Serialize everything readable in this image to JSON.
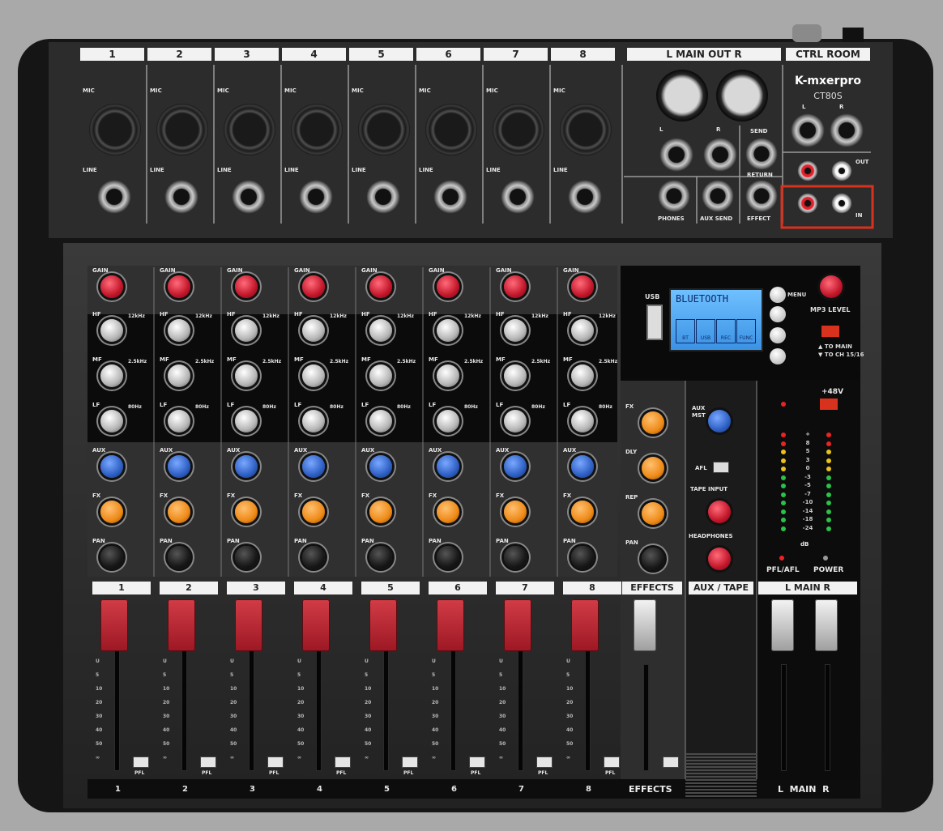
{
  "device": {
    "brand": "K-mxerpro",
    "model": "CT80S"
  },
  "channel_labels": [
    "1",
    "2",
    "3",
    "4",
    "5",
    "6",
    "7",
    "8"
  ],
  "header": {
    "main_out": "L  MAIN OUT  R",
    "ctrl_room": "CTRL ROOM"
  },
  "io_labels": {
    "mic": "MIC",
    "line": "LINE",
    "l": "L",
    "r": "R",
    "send": "SEND",
    "return": "RETURN",
    "phones": "PHONES",
    "aux_send": "AUX SEND",
    "effect": "EFFECT",
    "out": "OUT",
    "in": "IN"
  },
  "channel_knobs": {
    "gain": "GAIN",
    "hf": "HF",
    "mf": "MF",
    "lf": "LF",
    "aux": "AUX",
    "fx": "FX",
    "pan": "PAN",
    "hf_freq": "12kHz",
    "mf_freq": "2.5kHz",
    "lf_freq": "80Hz",
    "pfl": "PFL"
  },
  "mp3": {
    "display_text": "BLUETOOTH",
    "usb": "USB",
    "menu": "MENU",
    "level": "MP3 LEVEL",
    "to_main": "▲ TO MAIN",
    "to_ch": "▼ TO CH 15/16",
    "modes": [
      "BT",
      "USB",
      "REC",
      "FUNC"
    ]
  },
  "effects_section": {
    "fx": "FX",
    "dly": "DLY",
    "rep": "REP",
    "pan": "PAN",
    "strip": "EFFECTS",
    "bottom": "EFFECTS"
  },
  "aux_section": {
    "aux_mst": "AUX\nMST",
    "afl": "AFL",
    "tape_input": "TAPE INPUT",
    "headphones": "HEADPHONES",
    "strip": "AUX / TAPE"
  },
  "main_section": {
    "phantom": "+48V",
    "meter": [
      "+",
      "8",
      "5",
      "3",
      "0",
      "-3",
      "-5",
      "-7",
      "-10",
      "-14",
      "-18",
      "-24"
    ],
    "db": "dB",
    "pfl_afl": "PFL/AFL",
    "power": "POWER",
    "strip": "L  MAIN  R",
    "bottom": "L  MAIN  R"
  },
  "fader_scale": [
    "U",
    "5",
    "10",
    "20",
    "30",
    "40",
    "50",
    "∞"
  ],
  "highlight": {
    "target": "ctrl-room-in-rca",
    "color": "#d8321e"
  },
  "colors": {
    "gain_knob": "#d32a3c",
    "eq_knob": "#c8c8c8",
    "aux_knob": "#3c6fd0",
    "fx_knob": "#f08a1c",
    "pan_knob": "#1a1a1a",
    "lcd": "#4aa8f0"
  }
}
